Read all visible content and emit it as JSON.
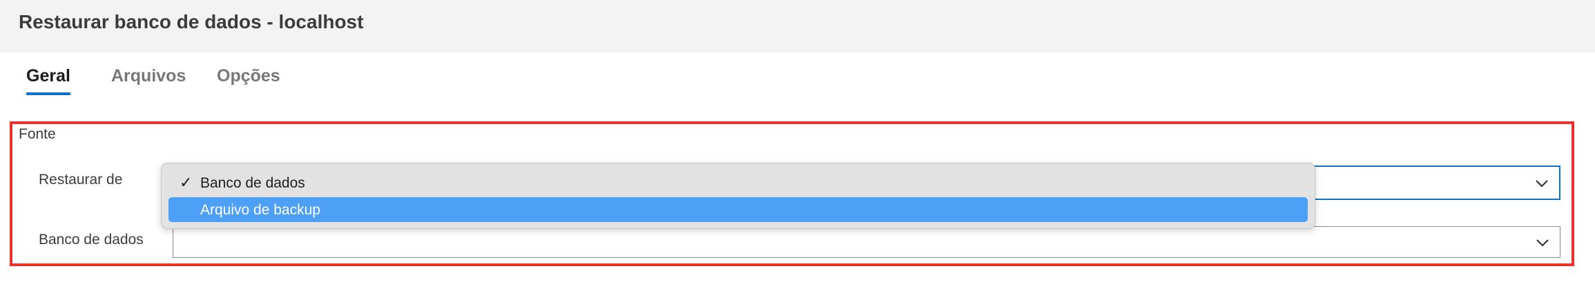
{
  "window": {
    "title": "Restaurar banco de dados - localhost"
  },
  "tabs": [
    {
      "label": "Geral",
      "active": true
    },
    {
      "label": "Arquivos",
      "active": false
    },
    {
      "label": "Opções",
      "active": false
    }
  ],
  "section": {
    "label": "Fonte",
    "fields": {
      "restore_from": {
        "label": "Restaurar de",
        "value": ""
      },
      "database": {
        "label": "Banco de dados",
        "value": ""
      }
    }
  },
  "dropdown": {
    "options": [
      {
        "label": "Banco de dados",
        "checked": true,
        "highlighted": false
      },
      {
        "label": "Arquivo de backup",
        "checked": false,
        "highlighted": true
      }
    ],
    "check_glyph": "✓"
  },
  "icons": {
    "select_arrow": "chevron-down-icon",
    "check": "checkmark-icon"
  },
  "colors": {
    "accent": "#0e6fc7",
    "focus_border": "#1471c8",
    "highlight_box": "#e8302d",
    "option_highlight": "#4ea0f7",
    "header_bg": "#f3f3f3",
    "dropdown_bg": "#e2e2e2"
  }
}
